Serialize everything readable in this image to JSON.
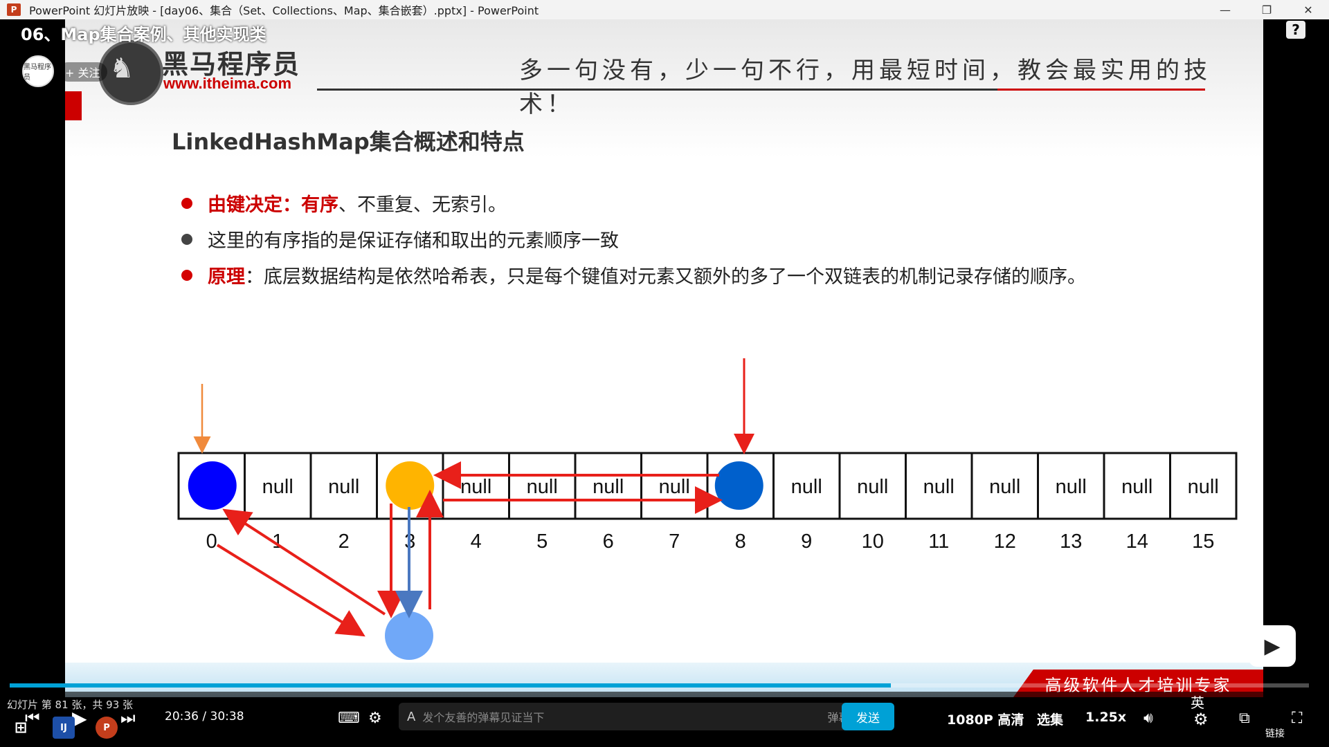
{
  "window": {
    "title": "PowerPoint 幻灯片放映 - [day06、集合（Set、Collections、Map、集合嵌套）.pptx] - PowerPoint",
    "app_icon_label": "P"
  },
  "video": {
    "title": "06、Map集合案例、其他实现类",
    "follow_label": "+ 关注",
    "avatar_label": "黑马程序员"
  },
  "slide": {
    "brand_name": "黑马程序员",
    "brand_url": "www.itheima.com",
    "slogan": "多一句没有，少一句不行，用最短时间，教会最实用的技术！",
    "heading": "LinkedHashMap集合概述和特点",
    "bullets": [
      {
        "lead": "由键决定：有序",
        "rest": "、不重复、无索引。",
        "dot_color": "#d40000"
      },
      {
        "lead": "",
        "rest": "这里的有序指的是保证存储和取出的元素顺序一致",
        "dot_color": "#444444"
      },
      {
        "lead": "原理",
        "rest": "：底层数据结构是依然哈希表，只是每个键值对元素又额外的多了一个双链表的机制记录存储的顺序。",
        "dot_color": "#d40000"
      }
    ],
    "array_cells": [
      "",
      "null",
      "null",
      "",
      "null",
      "null",
      "null",
      "null",
      "",
      "null",
      "null",
      "null",
      "null",
      "null",
      "null",
      "null"
    ],
    "indices": [
      "0",
      "1",
      "2",
      "3",
      "4",
      "5",
      "6",
      "7",
      "8",
      "9",
      "10",
      "11",
      "12",
      "13",
      "14",
      "15"
    ],
    "node_colors": {
      "index0": "#0000ff",
      "index3": "#ffb400",
      "index8": "#0060cc",
      "chained": "#70a8f8"
    },
    "motto": "高级软件人才培训专家"
  },
  "player": {
    "slide_status": "幻灯片 第 81 张，共 93 张",
    "time_current": "20:36",
    "time_separator": "/",
    "time_total": "30:38",
    "progress_fraction": 0.678,
    "danmu_placeholder": "发个友善的弹幕见证当下",
    "danmu_etiquette": "弹幕礼仪 >",
    "send_label": "发送",
    "quality": "1080P 高清",
    "episodes": "选集",
    "speed": "1.25x",
    "lang": "英",
    "link_label": "链接"
  }
}
